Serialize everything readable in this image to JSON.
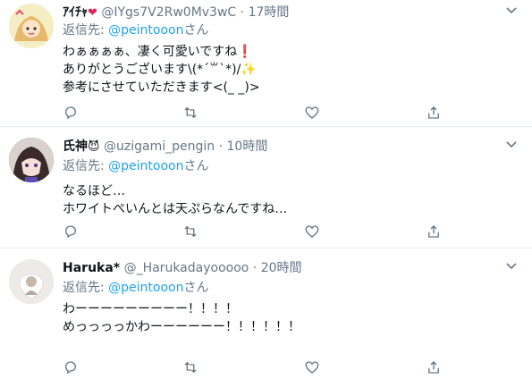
{
  "tweets": [
    {
      "name": "ｱｲﾁｬ",
      "name_emoji": "❤",
      "handle": "@IYgs7V2Rw0Mv3wC",
      "dot": "·",
      "time": "17時間",
      "reply_label": "返信先:",
      "reply_mention": "@peintooon",
      "reply_suffix": "さん",
      "text": "わぁぁぁぁ、凄く可愛いですね❗\nありがとうございます\\(*´꒳`*)/✨\n参考にさせていただきます<(_ _)>",
      "avatar_icon": "anime-avatar-icon",
      "avatar_color": "#f3e7b5"
    },
    {
      "name": "氏神",
      "name_emoji": "😈",
      "handle": "@uzigami_pengin",
      "dot": "·",
      "time": "10時間",
      "reply_label": "返信先:",
      "reply_mention": "@peintooon",
      "reply_suffix": "さん",
      "text": "なるほど…\nホワイトぺいんとは天ぷらなんですね…",
      "avatar_icon": "anime-avatar-icon",
      "avatar_color": "#4b3b3b"
    },
    {
      "name": "Haruka*",
      "name_emoji": "",
      "handle": "@_Harukadayooooo",
      "dot": "·",
      "time": "20時間",
      "reply_label": "返信先:",
      "reply_mention": "@peintooon",
      "reply_suffix": "さん",
      "text": "わーーーーーーーーー！！！！\nめっっっっかわーーーーーー！！！！！！",
      "avatar_icon": "photo-avatar-icon",
      "avatar_color": "#e9e5e2"
    }
  ],
  "colors": {
    "accent": "#1da1f2",
    "secondary_text": "#657786",
    "divider": "#e6ecf0"
  },
  "icons": [
    "reply-icon",
    "retweet-icon",
    "like-icon",
    "share-icon",
    "more-icon"
  ]
}
